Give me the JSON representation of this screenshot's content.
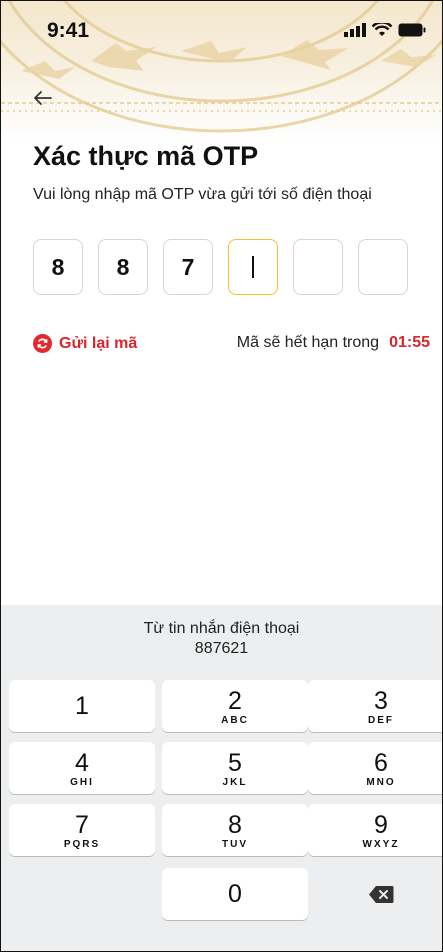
{
  "status_bar": {
    "time": "9:41"
  },
  "header": {
    "title": "Xác thực mã OTP",
    "subtitle": "Vui lòng nhập mã OTP vừa gửi tới số điện thoại"
  },
  "otp": {
    "digits": [
      "8",
      "8",
      "7",
      "",
      "",
      ""
    ],
    "active_index": 3
  },
  "resend": {
    "label": "Gửi lại mã"
  },
  "expiry": {
    "label": "Mã sẽ hết hạn trong",
    "time": "01:55"
  },
  "keyboard": {
    "suggestion_title": "Từ tin nhắn điện thoại",
    "suggestion_code": "887621",
    "keys": [
      {
        "num": "1",
        "letters": ""
      },
      {
        "num": "2",
        "letters": "ABC"
      },
      {
        "num": "3",
        "letters": "DEF"
      },
      {
        "num": "4",
        "letters": "GHI"
      },
      {
        "num": "5",
        "letters": "JKL"
      },
      {
        "num": "6",
        "letters": "MNO"
      },
      {
        "num": "7",
        "letters": "PQRS"
      },
      {
        "num": "8",
        "letters": "TUV"
      },
      {
        "num": "9",
        "letters": "WXYZ"
      },
      {
        "num": "0",
        "letters": ""
      }
    ]
  },
  "colors": {
    "accent_red": "#d8262c",
    "active_box_border": "#f2c230",
    "keyboard_bg": "#eceef0"
  },
  "icons": {
    "back": "arrow-left-icon",
    "resend": "refresh-icon",
    "delete": "backspace-icon"
  }
}
